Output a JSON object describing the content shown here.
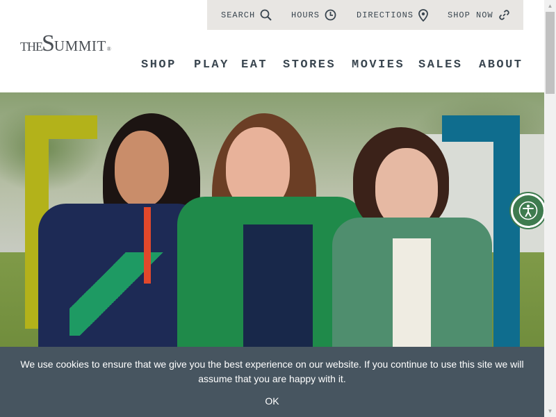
{
  "utility_bar": {
    "items": [
      {
        "label": "SEARCH",
        "icon": "search-icon"
      },
      {
        "label": "HOURS",
        "icon": "clock-icon"
      },
      {
        "label": "DIRECTIONS",
        "icon": "map-pin-icon"
      },
      {
        "label": "SHOP NOW",
        "icon": "link-icon"
      }
    ]
  },
  "logo": {
    "the": "THE",
    "s": "S",
    "ummit": "UMMIT",
    "reg": "®"
  },
  "nav": {
    "items": [
      {
        "label": "SHOP"
      },
      {
        "label": "PLAY"
      },
      {
        "label": "EAT"
      },
      {
        "label": "STORES"
      },
      {
        "label": "MOVIES"
      },
      {
        "label": "SALES"
      },
      {
        "label": "ABOUT"
      }
    ]
  },
  "hero": {
    "bracket_left_color": "#b3b21a",
    "bracket_right_color": "#0f6d8e"
  },
  "accessibility": {
    "icon": "accessibility-icon",
    "color": "#3e7b4f"
  },
  "cookie_banner": {
    "message": "We use cookies to ensure that we give you the best experience on our website. If you continue to use this site we will assume that you are happy with it.",
    "ok_label": "OK",
    "background": "#475560"
  },
  "colors": {
    "nav_text": "#3a4650",
    "utility_bg": "#e8e6e3"
  }
}
